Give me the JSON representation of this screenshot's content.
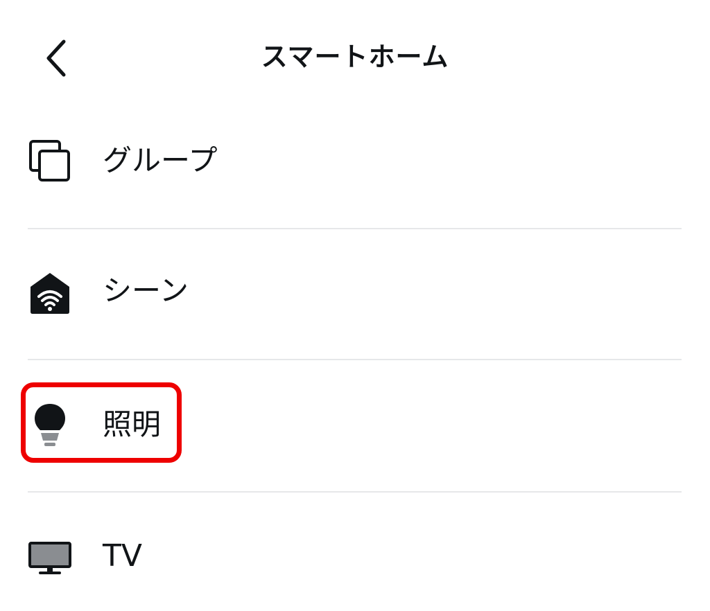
{
  "header": {
    "title": "スマートホーム",
    "back_icon": "chevron-left-icon"
  },
  "menu": {
    "items": [
      {
        "label": "グループ",
        "icon": "group-icon"
      },
      {
        "label": "シーン",
        "icon": "scene-home-wifi-icon"
      },
      {
        "label": "照明",
        "icon": "light-bulb-icon"
      },
      {
        "label": "TV",
        "icon": "tv-icon"
      }
    ]
  },
  "colors": {
    "text": "#111417",
    "divider": "#e6e7e9",
    "highlight": "#ee0000",
    "icon_dark": "#111417",
    "icon_gray": "#8a8d91"
  }
}
